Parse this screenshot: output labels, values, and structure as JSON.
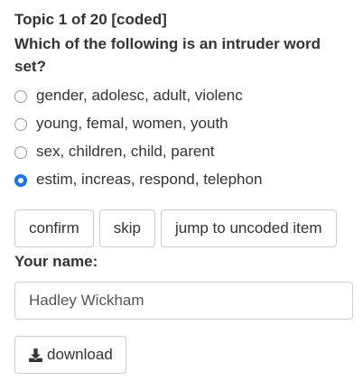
{
  "status": "Topic 1 of 20 [coded]",
  "question": "Which of the following is an intruder word set?",
  "options": [
    {
      "label": "gender, adolesc, adult, violenc",
      "selected": false
    },
    {
      "label": "young, femal, women, youth",
      "selected": false
    },
    {
      "label": "sex, children, child, parent",
      "selected": false
    },
    {
      "label": "estim, increas, respond, telephon",
      "selected": true
    }
  ],
  "buttons": {
    "confirm": "confirm",
    "skip": "skip",
    "jump": "jump to uncoded item"
  },
  "name": {
    "label": "Your name:",
    "value": "Hadley Wickham"
  },
  "download": {
    "label": "download",
    "icon": "download-icon"
  },
  "colors": {
    "radio_selected": "#1a73e8",
    "border": "#cccccc",
    "text": "#333333"
  }
}
